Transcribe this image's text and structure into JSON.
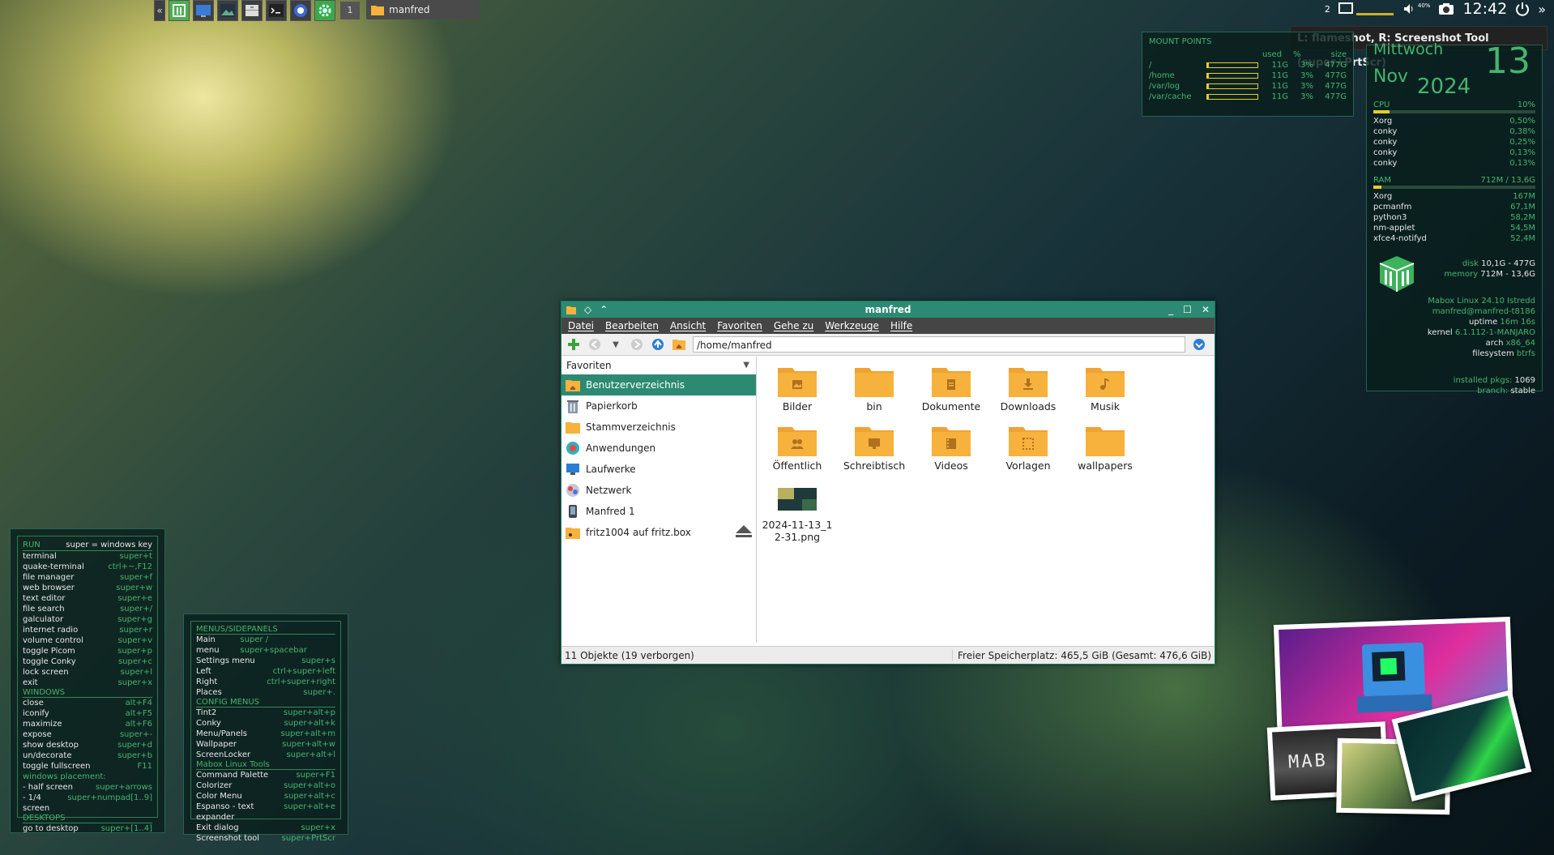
{
  "panel": {
    "workspace": "1",
    "task_title": "manfred",
    "tray_number": "2",
    "volume_level": "40%",
    "clock": "12:42",
    "tooltip": "L: flameshot, R: Screenshot Tool (super+PrtScr)"
  },
  "mounts": {
    "title": "MOUNT POINTS",
    "headers": [
      "used",
      "%",
      "size"
    ],
    "rows": [
      {
        "path": "/",
        "used": "11G",
        "pct": "3%",
        "size": "477G",
        "fill": 0.03
      },
      {
        "path": "/home",
        "used": "11G",
        "pct": "3%",
        "size": "477G",
        "fill": 0.03
      },
      {
        "path": "/var/log",
        "used": "11G",
        "pct": "3%",
        "size": "477G",
        "fill": 0.03
      },
      {
        "path": "/var/cache",
        "used": "11G",
        "pct": "3%",
        "size": "477G",
        "fill": 0.03
      }
    ]
  },
  "sys": {
    "weekday": "Mittwoch",
    "day": "13",
    "month": "Nov",
    "year": "2024",
    "cpu_label": "CPU",
    "cpu_pct": "10%",
    "cpu_fill": 0.1,
    "cpu_procs": [
      {
        "name": "Xorg",
        "val": "0,50%"
      },
      {
        "name": "conky",
        "val": "0,38%"
      },
      {
        "name": "conky",
        "val": "0,25%"
      },
      {
        "name": "conky",
        "val": "0,13%"
      },
      {
        "name": "conky",
        "val": "0,13%"
      }
    ],
    "ram_label": "RAM",
    "ram_val": "712M / 13,6G",
    "ram_fill": 0.05,
    "ram_procs": [
      {
        "name": "Xorg",
        "val": "167M"
      },
      {
        "name": "pcmanfm",
        "val": "67,1M"
      },
      {
        "name": "python3",
        "val": "58,2M"
      },
      {
        "name": "nm-applet",
        "val": "54,5M"
      },
      {
        "name": "xfce4-notifyd",
        "val": "52,4M"
      }
    ],
    "disk_label": "disk",
    "disk_val": "10,1G - 477G",
    "mem_label": "memory",
    "mem_val": "712M - 13,6G",
    "distro": "Mabox Linux 24.10 Istredd",
    "userhost": "manfred@manfred-t8186",
    "uptime_label": "uptime",
    "uptime_val": "16m 16s",
    "kernel_label": "kernel",
    "kernel_val": "6.1.112-1-MANJARO",
    "arch_label": "arch",
    "arch_val": "x86_64",
    "fs_label": "filesystem",
    "fs_val": "btrfs",
    "pkgs_label": "installed pkgs:",
    "pkgs_val": "1069",
    "branch_label": "branch:",
    "branch_val": "stable"
  },
  "run": {
    "title": "RUN",
    "title_key": "super = windows key",
    "items": [
      {
        "k": "terminal",
        "v": "super+t"
      },
      {
        "k": "quake-terminal",
        "v": "ctrl+~,F12"
      },
      {
        "k": "file manager",
        "v": "super+f"
      },
      {
        "k": "web browser",
        "v": "super+w"
      },
      {
        "k": "text editor",
        "v": "super+e"
      },
      {
        "k": "file search",
        "v": "super+/"
      },
      {
        "k": "galculator",
        "v": "super+g"
      },
      {
        "k": "internet radio",
        "v": "super+r"
      },
      {
        "k": "volume control",
        "v": "super+v"
      },
      {
        "k": "toggle Picom",
        "v": "super+p"
      },
      {
        "k": "toggle Conky",
        "v": "super+c"
      },
      {
        "k": "lock screen",
        "v": "super+l"
      },
      {
        "k": "exit",
        "v": "super+x"
      }
    ],
    "windows_title": "WINDOWS",
    "windows": [
      {
        "k": "close",
        "v": "alt+F4"
      },
      {
        "k": "iconify",
        "v": "alt+F5"
      },
      {
        "k": "maximize",
        "v": "alt+F6"
      },
      {
        "k": "expose",
        "v": "super+-"
      },
      {
        "k": "show desktop",
        "v": "super+d"
      },
      {
        "k": "un/decorate",
        "v": "super+b"
      },
      {
        "k": "toggle fullscreen",
        "v": "F11"
      }
    ],
    "placement_title": "windows placement:",
    "placement": [
      {
        "k": " - half screen",
        "v": "super+arrows"
      },
      {
        "k": " - 1/4 screen",
        "v": "super+numpad[1..9]"
      }
    ],
    "desktops_title": "DESKTOPS",
    "desktops": [
      {
        "k": "go to desktop",
        "v": "super+[1..4]"
      }
    ]
  },
  "menus": {
    "title": "MENUS/SIDEPANELS",
    "items": [
      {
        "k": "Main menu",
        "v": "super / super+spacebar"
      },
      {
        "k": "Settings menu",
        "v": "super+s"
      },
      {
        "k": "Left",
        "v": "ctrl+super+left"
      },
      {
        "k": "Right",
        "v": "ctrl+super+right"
      },
      {
        "k": "Places",
        "v": "super+."
      }
    ],
    "config_title": "CONFIG MENUS",
    "config": [
      {
        "k": "Tint2",
        "v": "super+alt+p"
      },
      {
        "k": "Conky",
        "v": "super+alt+k"
      },
      {
        "k": "Menu/Panels",
        "v": "super+alt+m"
      },
      {
        "k": "Wallpaper",
        "v": "super+alt+w"
      },
      {
        "k": "ScreenLocker",
        "v": "super+alt+l"
      }
    ],
    "tools_title": "Mabox Linux Tools",
    "tools": [
      {
        "k": "Command Palette",
        "v": "super+F1"
      },
      {
        "k": "Colorizer",
        "v": "super+alt+o"
      },
      {
        "k": "Color Menu",
        "v": "super+alt+c"
      },
      {
        "k": "Espanso - text expander",
        "v": "super+alt+e"
      },
      {
        "k": "Exit dialog",
        "v": "super+x"
      },
      {
        "k": "Screenshot tool",
        "v": "super+PrtScr"
      }
    ]
  },
  "fm": {
    "title": "manfred",
    "menu": [
      "Datei",
      "Bearbeiten",
      "Ansicht",
      "Favoriten",
      "Gehe zu",
      "Werkzeuge",
      "Hilfe"
    ],
    "path": "/home/manfred",
    "sidebar_title": "Favoriten",
    "sidebar": [
      {
        "label": "Benutzerverzeichnis",
        "icon": "home-folder-icon"
      },
      {
        "label": "Papierkorb",
        "icon": "trash-icon"
      },
      {
        "label": "Stammverzeichnis",
        "icon": "folder-icon"
      },
      {
        "label": "Anwendungen",
        "icon": "applications-icon"
      },
      {
        "label": "Laufwerke",
        "icon": "monitor-icon"
      },
      {
        "label": "Netzwerk",
        "icon": "network-icon"
      },
      {
        "label": "Manfred 1",
        "icon": "phone-icon"
      },
      {
        "label": "fritz1004 auf fritz.box",
        "icon": "network-folder-icon"
      }
    ],
    "files": [
      {
        "name": "Bilder",
        "icon": "pictures-folder-icon"
      },
      {
        "name": "bin",
        "icon": "folder-icon"
      },
      {
        "name": "Dokumente",
        "icon": "documents-folder-icon"
      },
      {
        "name": "Downloads",
        "icon": "downloads-folder-icon"
      },
      {
        "name": "Musik",
        "icon": "music-folder-icon"
      },
      {
        "name": "Öffentlich",
        "icon": "public-folder-icon"
      },
      {
        "name": "Schreibtisch",
        "icon": "desktop-folder-icon"
      },
      {
        "name": "Videos",
        "icon": "videos-folder-icon"
      },
      {
        "name": "Vorlagen",
        "icon": "templates-folder-icon"
      },
      {
        "name": "wallpapers",
        "icon": "folder-icon"
      },
      {
        "name": "2024-11-13_12-31.png",
        "icon": "image-thumbnail-icon"
      }
    ],
    "status_left": "11 Objekte (19 verborgen)",
    "status_right": "Freier Speicherplatz: 465,5 GiB (Gesamt: 476,6 GiB)"
  },
  "logo_text": "MAB"
}
